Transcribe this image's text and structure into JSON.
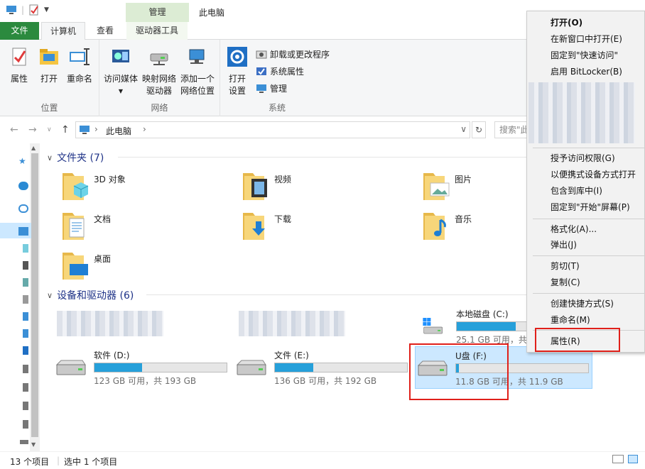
{
  "titlebar": {
    "manage_tab": "管理",
    "window_title": "此电脑",
    "controls": [
      "—",
      "☐",
      "✕"
    ]
  },
  "tabs": {
    "file": "文件",
    "computer": "计算机",
    "view": "查看",
    "drive_tools": "驱动器工具"
  },
  "ribbon": {
    "location": {
      "name": "位置",
      "properties": "属性",
      "open": "打开",
      "rename": "重命名"
    },
    "network": {
      "name": "网络",
      "access_media": "访问媒体",
      "map_drive_1": "映射网络",
      "map_drive_2": "驱动器",
      "add_location_1": "添加一个",
      "add_location_2": "网络位置"
    },
    "system": {
      "name": "系统",
      "open_settings_1": "打开",
      "open_settings_2": "设置",
      "uninstall": "卸载或更改程序",
      "sys_props": "系统属性",
      "manage": "管理"
    }
  },
  "address": {
    "crumb": "此电脑",
    "search_placeholder": "搜索\"此电脑\""
  },
  "folders_group": {
    "title": "文件夹 (7)"
  },
  "folders": [
    {
      "name": "3D 对象"
    },
    {
      "name": "视频"
    },
    {
      "name": "图片"
    },
    {
      "name": "文档"
    },
    {
      "name": "下载"
    },
    {
      "name": "音乐"
    },
    {
      "name": "桌面"
    }
  ],
  "drives_group": {
    "title": "设备和驱动器 (6)"
  },
  "drives": [
    {
      "name": "本地磁盘 (C:)",
      "size": "25.1 GB 可用，共 ",
      "used": 0.6
    },
    {
      "name": "软件 (D:)",
      "size": "123 GB 可用，共 193 GB",
      "used": 0.36
    },
    {
      "name": "文件 (E:)",
      "size": "136 GB 可用，共 192 GB",
      "used": 0.29
    },
    {
      "name": "U盘 (F:)",
      "size": "11.8 GB 可用，共 11.9 GB",
      "used": 0.01
    }
  ],
  "status": {
    "count": "13 个项目",
    "selected": "选中 1 个项目"
  },
  "context_menu": {
    "open": "打开(O)",
    "open_new": "在新窗口中打开(E)",
    "pin_quick": "固定到\"快速访问\"",
    "bitlocker": "启用 BitLocker(B)",
    "grant": "授予访问权限(G)",
    "portable": "以便携式设备方式打开",
    "library": "包含到库中(I)",
    "pin_start": "固定到\"开始\"屏幕(P)",
    "format": "格式化(A)...",
    "eject": "弹出(J)",
    "cut": "剪切(T)",
    "copy": "复制(C)",
    "shortcut": "创建快捷方式(S)",
    "rename": "重命名(M)",
    "properties": "属性(R)"
  },
  "colors": {
    "accent": "#2b8a3e",
    "selection": "#cce8ff",
    "bar": "#26a0da",
    "highlight": "#e0201a"
  }
}
